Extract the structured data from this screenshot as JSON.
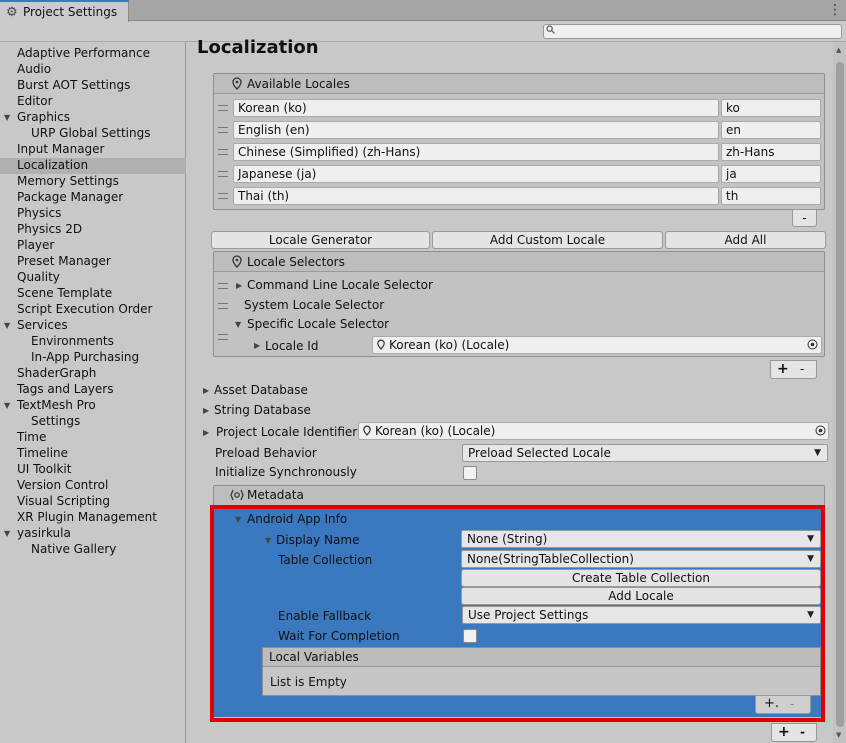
{
  "window": {
    "tab_title": "Project Settings",
    "menu_icon": "kebab-menu-icon"
  },
  "search": {
    "placeholder": ""
  },
  "sidebar": {
    "items": [
      {
        "label": "Adaptive Performance"
      },
      {
        "label": "Audio"
      },
      {
        "label": "Burst AOT Settings"
      },
      {
        "label": "Editor"
      },
      {
        "label": "Graphics"
      },
      {
        "label": "URP Global Settings"
      },
      {
        "label": "Input Manager"
      },
      {
        "label": "Localization"
      },
      {
        "label": "Memory Settings"
      },
      {
        "label": "Package Manager"
      },
      {
        "label": "Physics"
      },
      {
        "label": "Physics 2D"
      },
      {
        "label": "Player"
      },
      {
        "label": "Preset Manager"
      },
      {
        "label": "Quality"
      },
      {
        "label": "Scene Template"
      },
      {
        "label": "Script Execution Order"
      },
      {
        "label": "Services"
      },
      {
        "label": "Environments"
      },
      {
        "label": "In-App Purchasing"
      },
      {
        "label": "ShaderGraph"
      },
      {
        "label": "Tags and Layers"
      },
      {
        "label": "TextMesh Pro"
      },
      {
        "label": "Settings"
      },
      {
        "label": "Time"
      },
      {
        "label": "Timeline"
      },
      {
        "label": "UI Toolkit"
      },
      {
        "label": "Version Control"
      },
      {
        "label": "Visual Scripting"
      },
      {
        "label": "XR Plugin Management"
      },
      {
        "label": "yasirkula"
      },
      {
        "label": "Native Gallery"
      }
    ]
  },
  "main": {
    "title": "Localization",
    "available_locales": {
      "header": "Available Locales",
      "rows": [
        {
          "name": "Korean (ko)",
          "code": "ko"
        },
        {
          "name": "English (en)",
          "code": "en"
        },
        {
          "name": "Chinese (Simplified) (zh-Hans)",
          "code": "zh-Hans"
        },
        {
          "name": "Japanese (ja)",
          "code": "ja"
        },
        {
          "name": "Thai (th)",
          "code": "th"
        }
      ],
      "remove": "-"
    },
    "buttons": {
      "generator": "Locale Generator",
      "custom": "Add Custom Locale",
      "add_all": "Add All"
    },
    "selectors": {
      "header": "Locale Selectors",
      "items": [
        "Command Line Locale Selector",
        "System Locale Selector",
        "Specific Locale Selector"
      ],
      "locale_id_label": "Locale Id",
      "locale_id_value": "Korean (ko) (Locale)",
      "add": "+",
      "remove": "-"
    },
    "asset_database": "Asset Database",
    "string_database": "String Database",
    "project_locale_identifier": {
      "label": "Project Locale Identifier",
      "value": "Korean (ko) (Locale)"
    },
    "preload_behavior": {
      "label": "Preload Behavior",
      "value": "Preload Selected Locale"
    },
    "init_sync": {
      "label": "Initialize Synchronously"
    },
    "metadata": {
      "header": "Metadata",
      "android": "Android App Info",
      "display_name": {
        "label": "Display Name",
        "value": "None (String)"
      },
      "table_collection": {
        "label": "Table Collection",
        "value": "None(StringTableCollection)"
      },
      "create_table": "Create Table Collection",
      "add_locale": "Add Locale",
      "enable_fallback": {
        "label": "Enable Fallback",
        "value": "Use Project Settings"
      },
      "wait_completion": {
        "label": "Wait For Completion"
      },
      "local_vars": {
        "header": "Local Variables",
        "empty": "List is Empty",
        "add": "+.",
        "remove": "-"
      },
      "add": "+",
      "remove": "-"
    }
  },
  "colors": {
    "selection": "#3a79bf",
    "highlight_box": "#e00000"
  }
}
